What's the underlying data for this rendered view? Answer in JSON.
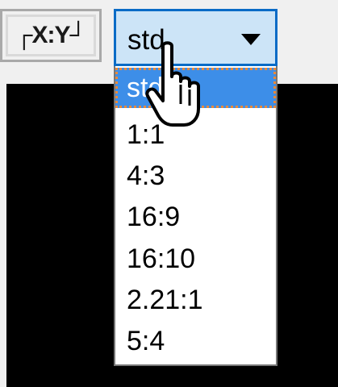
{
  "aspect_button": {
    "label": "┌X:Y┘"
  },
  "aspect_select": {
    "selected_value": "std",
    "options": [
      "std",
      "1:1",
      "4:3",
      "16:9",
      "16:10",
      "2.21:1",
      "5:4"
    ]
  },
  "colors": {
    "select_border": "#0a6bc6",
    "select_fill": "#cce4f7",
    "highlight": "#3d8ee8",
    "focus_ring": "#e8893a",
    "video_area": "#000000"
  },
  "icons": {
    "dropdown": "caret-down-icon",
    "cursor": "hand-pointer-icon"
  }
}
